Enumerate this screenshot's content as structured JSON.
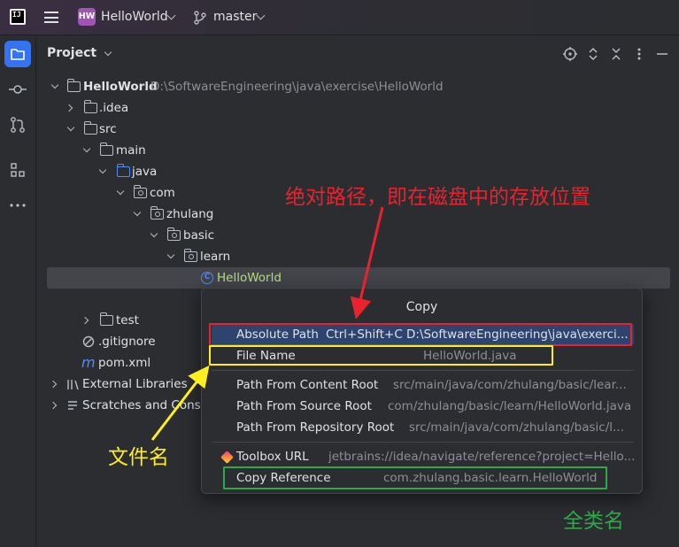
{
  "titlebar": {
    "app_logo": "IJ",
    "project_badge": "HW",
    "project_name": "HelloWorld",
    "branch_name": "master"
  },
  "panel": {
    "title": "Project"
  },
  "tree": {
    "root_name": "HelloWorld",
    "root_path": "D:\\SoftwareEngineering\\java\\exercise\\HelloWorld",
    "idea": ".idea",
    "src": "src",
    "main": "main",
    "java": "java",
    "com": "com",
    "zhulang": "zhulang",
    "basic": "basic",
    "learn": "learn",
    "class_badge": "C",
    "helloworld": "HelloWorld",
    "test": "test",
    "gitignore": ".gitignore",
    "pom_icon": "m",
    "pom": "pom.xml",
    "external_libraries": "External Libraries",
    "scratches": "Scratches and Cons"
  },
  "popup": {
    "title": "Copy",
    "items": [
      {
        "label": "Absolute Path",
        "shortcut": "Ctrl+Shift+C",
        "value": "D:\\SoftwareEngineering\\java\\exerci..."
      },
      {
        "label": "File Name",
        "value": "HelloWorld.java"
      },
      {
        "label": "Path From Content Root",
        "value": "src/main/java/com/zhulang/basic/lear..."
      },
      {
        "label": "Path From Source Root",
        "value": "com/zhulang/basic/learn/HelloWorld.java"
      },
      {
        "label": "Path From Repository Root",
        "value": "src/main/java/com/zhulang/basic/l..."
      },
      {
        "label": "Toolbox URL",
        "value": "jetbrains://idea/navigate/reference?project=Hello..."
      },
      {
        "label": "Copy Reference",
        "value": "com.zhulang.basic.learn.HelloWorld"
      }
    ]
  },
  "annotations": {
    "absolute_note": "绝对路径，即在磁盘中的存放位置",
    "filename_note": "文件名",
    "reference_note": "全类名",
    "colors": {
      "red": "#e8232e",
      "yellow": "#ffee1d",
      "green": "#2ea84a"
    }
  }
}
